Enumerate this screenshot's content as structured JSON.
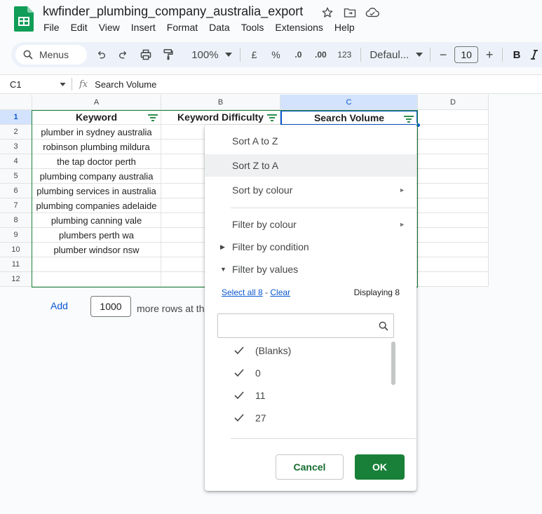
{
  "app": {
    "doc_title": "kwfinder_plumbing_company_australia_export",
    "menu": [
      "File",
      "Edit",
      "View",
      "Insert",
      "Format",
      "Data",
      "Tools",
      "Extensions",
      "Help"
    ],
    "brand_color": "#188038"
  },
  "toolbar": {
    "menus_label": "Menus",
    "zoom": "100%",
    "currency": "£",
    "percent": "%",
    "dec_decrease": ".0",
    "dec_increase": ".00",
    "number_format": "123",
    "font": "Defaul...",
    "font_size": "10",
    "minus": "−",
    "plus": "+",
    "bold": "B"
  },
  "formula_bar": {
    "cell_ref": "C1",
    "fx": "fx",
    "content": "Search Volume"
  },
  "grid": {
    "columns": [
      "A",
      "B",
      "C",
      "D"
    ],
    "rows": [
      "1",
      "2",
      "3",
      "4",
      "5",
      "6",
      "7",
      "8",
      "9",
      "10",
      "11",
      "12"
    ],
    "headers": [
      "Keyword",
      "Keyword Difficulty",
      "Search Volume"
    ],
    "keywords": [
      "plumber in sydney australia",
      "robinson plumbing mildura",
      "the tap doctor perth",
      "plumbing company australia",
      "plumbing services in australia",
      "plumbing companies adelaide",
      "plumbing canning vale",
      "plumbers perth wa",
      "plumber windsor nsw"
    ]
  },
  "add_rows": {
    "add_label": "Add",
    "count": "1000",
    "suffix": "more rows at th"
  },
  "filter_menu": {
    "sort_az": "Sort A to Z",
    "sort_za": "Sort Z to A",
    "sort_colour": "Sort by colour",
    "filter_colour": "Filter by colour",
    "filter_condition": "Filter by condition",
    "filter_values": "Filter by values",
    "select_all": "Select all 8",
    "link_sep": " - ",
    "clear": "Clear",
    "displaying": "Displaying 8",
    "values": [
      "(Blanks)",
      "0",
      "11",
      "27"
    ],
    "cancel": "Cancel",
    "ok": "OK"
  }
}
